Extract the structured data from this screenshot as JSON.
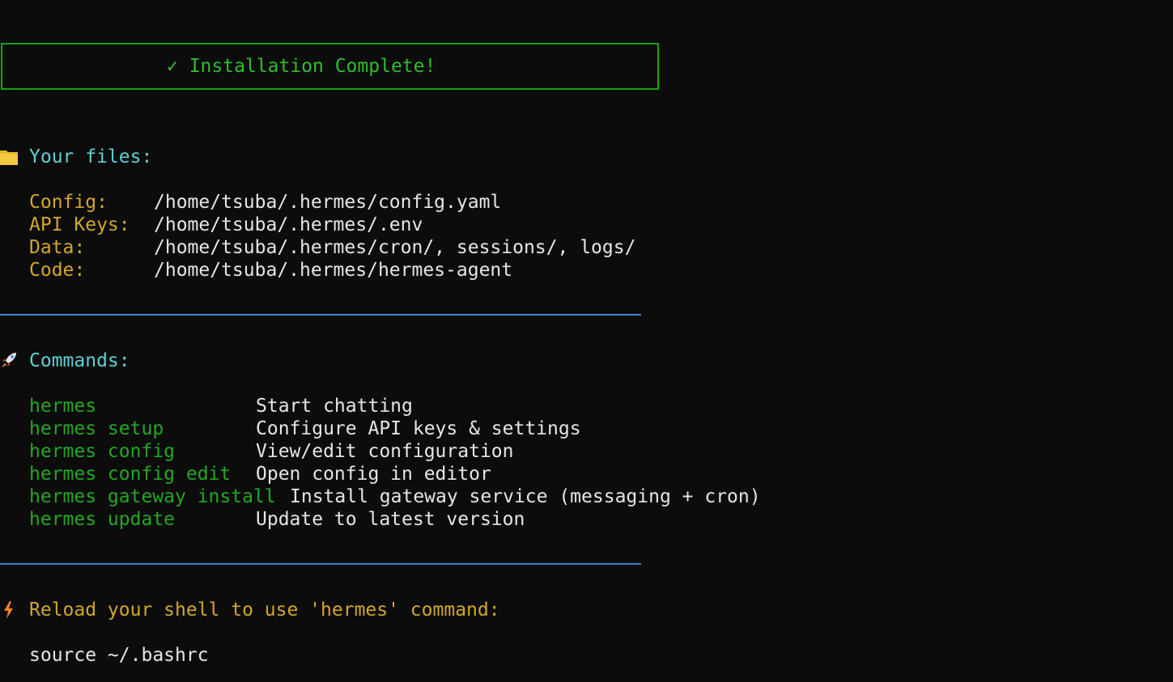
{
  "banner": {
    "title": "✓ Installation Complete!"
  },
  "files": {
    "heading": "Your files:",
    "icon": "folder-icon",
    "rows": [
      {
        "label": "Config:",
        "value": "/home/tsuba/.hermes/config.yaml"
      },
      {
        "label": "API Keys:",
        "value": "/home/tsuba/.hermes/.env"
      },
      {
        "label": "Data:",
        "value": "/home/tsuba/.hermes/cron/, sessions/, logs/"
      },
      {
        "label": "Code:",
        "value": "/home/tsuba/.hermes/hermes-agent"
      }
    ]
  },
  "commands": {
    "heading": "Commands:",
    "icon": "rocket-icon",
    "rows": [
      {
        "cmd": "hermes",
        "desc": "Start chatting"
      },
      {
        "cmd": "hermes setup",
        "desc": "Configure API keys & settings"
      },
      {
        "cmd": "hermes config",
        "desc": "View/edit configuration"
      },
      {
        "cmd": "hermes config edit",
        "desc": "Open config in editor"
      },
      {
        "cmd": "hermes gateway install",
        "desc": "Install gateway service (messaging + cron)"
      },
      {
        "cmd": "hermes update",
        "desc": "Update to latest version"
      }
    ]
  },
  "reload": {
    "icon": "lightning-icon",
    "heading": "Reload your shell to use 'hermes' command:",
    "command": "source ~/.bashrc"
  },
  "colors": {
    "background": "#0c0c0c",
    "banner_border": "#16a316",
    "heading_cyan": "#5fcfd3",
    "label_gold": "#d3a72a",
    "command_green": "#23a723",
    "rule_blue": "#3d86c9"
  }
}
